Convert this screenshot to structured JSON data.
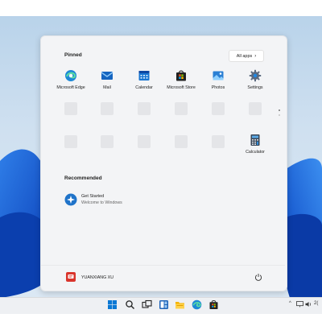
{
  "start_menu": {
    "pinned_title": "Pinned",
    "all_apps_label": "All apps",
    "pinned_apps": [
      {
        "label": "Microsoft Edge",
        "icon": "edge-icon"
      },
      {
        "label": "Mail",
        "icon": "mail-icon"
      },
      {
        "label": "Calendar",
        "icon": "calendar-icon"
      },
      {
        "label": "Microsoft Store",
        "icon": "store-icon"
      },
      {
        "label": "Photos",
        "icon": "photos-icon"
      },
      {
        "label": "Settings",
        "icon": "gear-icon"
      },
      {
        "label": "Calculator",
        "icon": "calculator-icon"
      }
    ],
    "recommended_title": "Recommended",
    "recommended": [
      {
        "title": "Get Started",
        "subtitle": "Welcome to Windows",
        "icon": "get-started-icon"
      }
    ],
    "user": {
      "name": "YUANXIANG XU",
      "icon": "avatar"
    },
    "power_icon": "power-icon"
  },
  "taskbar": {
    "icons": [
      "windows-start-icon",
      "search-icon",
      "task-view-icon",
      "widgets-icon",
      "file-explorer-icon",
      "edge-icon",
      "store-icon"
    ],
    "tray": {
      "chevron": "^",
      "clock_fragment": "2("
    }
  },
  "colors": {
    "accent": "#0067c0",
    "menu_bg": "#f3f4f6",
    "taskbar_bg": "#eef0f3"
  }
}
